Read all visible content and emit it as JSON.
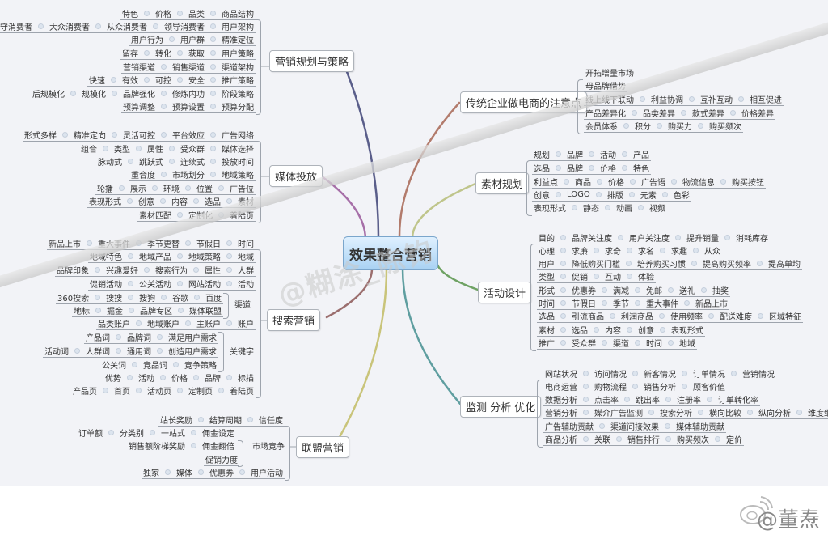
{
  "central": "效果整合营销",
  "colors": {
    "background": "#f2f3f7",
    "central_fill": "#a9d2f3",
    "link_marketing": "#5a5e8a",
    "link_media": "#a66fa8",
    "link_traditional": "#b27b6c",
    "link_material": "#bfc58b",
    "link_activity": "#6fa264",
    "link_search": "#9b6e6e",
    "link_alliance": "#c9c47a",
    "link_monitor": "#5f9ea0"
  },
  "branches": {
    "marketing": {
      "title": "营销规划与策略",
      "rows": [
        [
          "特色",
          "价格",
          "品类",
          "商品结构"
        ],
        [
          "保守消费者",
          "大众消费者",
          "从众消费者",
          "领导消费者",
          "用户架构"
        ],
        [
          "用户行为",
          "用户群",
          "精准定位"
        ],
        [
          "留存",
          "转化",
          "获取",
          "用户策略"
        ],
        [
          "营销渠道",
          "销售渠道",
          "渠道架构"
        ],
        [
          "快速",
          "有效",
          "可控",
          "安全",
          "推广策略"
        ],
        [
          "后规模化",
          "规模化",
          "品牌强化",
          "修炼内功",
          "阶段策略"
        ],
        [
          "预算调整",
          "预算设置",
          "预算分配"
        ]
      ]
    },
    "media": {
      "title": "媒体投放",
      "rows": [
        [
          "形式多样",
          "精准定向",
          "灵活可控",
          "平台效应",
          "广告网络"
        ],
        [
          "组合",
          "类型",
          "属性",
          "受众群",
          "媒体选择"
        ],
        [
          "脉动式",
          "跳跃式",
          "连续式",
          "投放时间"
        ],
        [
          "重合度",
          "市场划分",
          "地域策略"
        ],
        [
          "轮播",
          "展示",
          "环境",
          "位置",
          "广告位"
        ],
        [
          "表现形式",
          "创意",
          "内容",
          "选品",
          "素材"
        ],
        [
          "素材匹配",
          "定制化",
          "着陆页"
        ]
      ]
    },
    "search": {
      "title": "搜索营销",
      "rows": [
        [
          "新品上市",
          "重大事件",
          "季节更替",
          "节假日",
          "时间"
        ],
        [
          "地域特色",
          "地域产品",
          "地域策略",
          "地域"
        ],
        [
          "品牌印象",
          "兴趣爱好",
          "搜索行为",
          "属性",
          "人群"
        ],
        [
          "促销活动",
          "公关活动",
          "网站活动",
          "活动"
        ],
        [
          "360搜索",
          "搜搜",
          "搜狗",
          "谷歌",
          "百度"
        ],
        [
          "地标",
          "掘金",
          "品牌专区",
          "媒体联盟"
        ],
        [
          "品类账户",
          "地域账户",
          "主账户",
          "账户"
        ],
        [
          "产品词",
          "品牌词",
          "满足用户需求"
        ],
        [
          "活动词",
          "人群词",
          "通用词",
          "创造用户需求"
        ],
        [
          "公关词",
          "竞品词",
          "竞争策略"
        ],
        [
          "优势",
          "活动",
          "价格",
          "品牌",
          "标描"
        ],
        [
          "产品页",
          "首页",
          "活动页",
          "定制页",
          "着陆页"
        ]
      ],
      "group_labels": {
        "channel": "渠道",
        "keyword": "关键字"
      }
    },
    "alliance": {
      "title": "联盟营销",
      "rows": [
        [
          "站长奖励",
          "结算周期",
          "信任度"
        ],
        [
          "订单额",
          "分类别",
          "一站式",
          "佣金设定"
        ],
        [
          "销售额阶梯奖励",
          "佣金翻倍"
        ],
        [
          "促销力度"
        ],
        [
          "独家",
          "媒体",
          "优惠券",
          "用户活动"
        ]
      ],
      "group_label": "市场竞争"
    },
    "traditional": {
      "title": "传统企业做电商的注意点",
      "rows": [
        [
          "开拓增量市场"
        ],
        [
          "母品牌借势"
        ],
        [
          "线上线下联动",
          "利益协调",
          "互补互动",
          "相互促进"
        ],
        [
          "产品差异化",
          "品类差异",
          "款式差异",
          "价格差异"
        ],
        [
          "会员体系",
          "积分",
          "购买力",
          "购买频次"
        ]
      ]
    },
    "material": {
      "title": "素材规划",
      "rows": [
        [
          "规划",
          "品牌",
          "活动",
          "产品"
        ],
        [
          "选品",
          "品牌",
          "价格",
          "特色"
        ],
        [
          "利益点",
          "商品",
          "价格",
          "广告语",
          "物流信息",
          "购买按钮"
        ],
        [
          "创意",
          "LOGO",
          "排版",
          "元素",
          "色彩"
        ],
        [
          "表现形式",
          "静态",
          "动画",
          "视频"
        ]
      ]
    },
    "activity": {
      "title": "活动设计",
      "rows": [
        [
          "目的",
          "品牌关注度",
          "用户关注度",
          "提升销量",
          "消耗库存"
        ],
        [
          "心理",
          "求廉",
          "求奇",
          "求名",
          "求趣",
          "从众"
        ],
        [
          "用户",
          "降低购买门槛",
          "培养购买习惯",
          "提高购买频率",
          "提高单均"
        ],
        [
          "类型",
          "促销",
          "互动",
          "体验"
        ],
        [
          "形式",
          "优惠券",
          "满减",
          "免邮",
          "送礼",
          "抽奖"
        ],
        [
          "时间",
          "节假日",
          "季节",
          "重大事件",
          "新品上市"
        ],
        [
          "选品",
          "引流商品",
          "利润商品",
          "使用频率",
          "配送难度",
          "区域特征"
        ],
        [
          "素材",
          "选品",
          "内容",
          "创意",
          "表现形式"
        ],
        [
          "推广",
          "受众群",
          "渠道",
          "时间",
          "地域"
        ]
      ]
    },
    "monitor": {
      "title": "监测 分析 优化",
      "rows": [
        [
          "网站状况",
          "访问情况",
          "新客情况",
          "订单情况",
          "营销情况"
        ],
        [
          "电商运营",
          "购物流程",
          "销售分析",
          "顾客价值"
        ],
        [
          "数据分析",
          "点击率",
          "跳出率",
          "注册率",
          "订单转化率"
        ],
        [
          "营销分析",
          "媒介广告监测",
          "搜索分析",
          "横向比较",
          "纵向分析",
          "维度细分"
        ],
        [
          "广告辅助贡献",
          "渠道间接效果",
          "媒体辅助贡献"
        ],
        [
          "商品分析",
          "关联",
          "销售排行",
          "购买频次",
          "定价"
        ]
      ]
    }
  },
  "watermark": "@糊涂_陈钧",
  "credit": "@董焘"
}
